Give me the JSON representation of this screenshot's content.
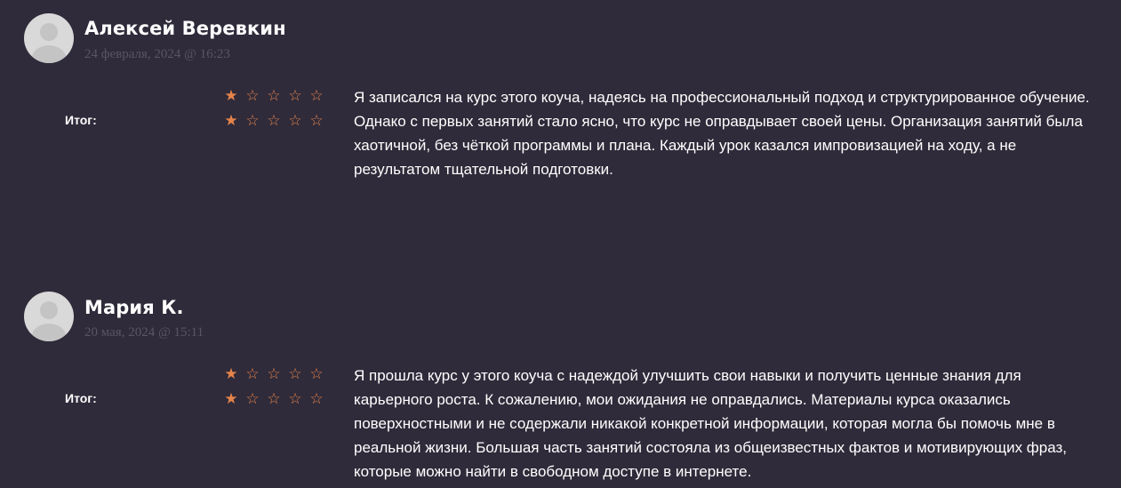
{
  "reviews": [
    {
      "author": "Алексей Веревкин",
      "date": "24 февраля, 2024 @ 16:23",
      "total_label": "Итог:",
      "rating_rows": [
        1,
        1
      ],
      "max_rating": 5,
      "text": "Я записался на курс этого коуча, надеясь на профессиональный подход и структурированное обучение. Однако с первых занятий стало ясно, что курс не оправдывает своей цены. Организация занятий была хаотичной, без чёткой программы и плана. Каждый урок казался импровизацией на ходу, а не результатом тщательной подготовки."
    },
    {
      "author": "Мария К.",
      "date": "20 мая, 2024 @ 15:11",
      "total_label": "Итог:",
      "rating_rows": [
        1,
        1
      ],
      "max_rating": 5,
      "text": "Я прошла курс у этого коуча с надеждой улучшить свои навыки и получить ценные знания для карьерного роста. К сожалению, мои ожидания не оправдались. Материалы курса оказались поверхностными и не содержали никакой конкретной информации, которая могла бы помочь мне в реальной жизни. Большая часть занятий состояла из общеизвестных фактов и мотивирующих фраз, которые можно найти в свободном доступе в интернете."
    }
  ],
  "colors": {
    "background": "#2f2b3a",
    "star": "#e6834a",
    "date": "#5a5566",
    "avatar": "#d9d9d9"
  },
  "icons": {
    "avatar": "default-user-avatar-icon",
    "star_filled": "star-filled-icon",
    "star_empty": "star-outline-icon"
  }
}
